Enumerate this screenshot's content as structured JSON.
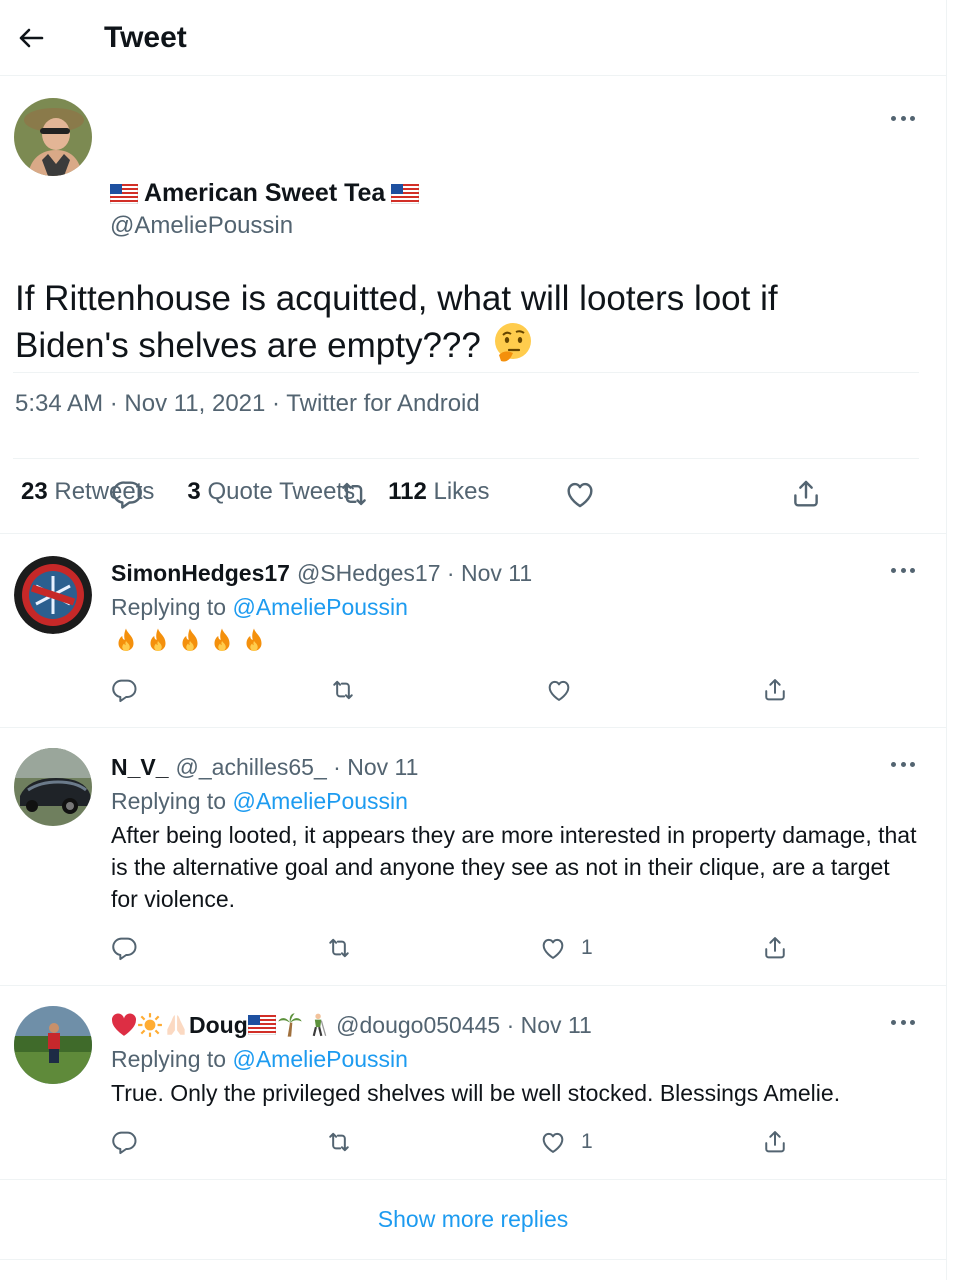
{
  "header": {
    "title": "Tweet"
  },
  "tweet": {
    "author_name": "American Sweet Tea",
    "author_handle": "@AmeliePoussin",
    "text": "If Rittenhouse is acquitted, what will looters loot if Biden's shelves are empty???",
    "time": "5:34 AM",
    "date": "Nov 11, 2021",
    "source": "Twitter for Android",
    "separator": " · ",
    "stats": {
      "retweets_count": "23",
      "retweets_label": "Retweets",
      "quotes_count": "3",
      "quotes_label": "Quote Tweets",
      "likes_count": "112",
      "likes_label": "Likes"
    }
  },
  "replies": [
    {
      "name": "SimonHedges17",
      "handle": "@SHedges17",
      "date": "· Nov 11",
      "replying_label": "Replying to",
      "replying_to": "@AmeliePoussin",
      "text": "",
      "likes": ""
    },
    {
      "name": "N_V_",
      "handle": "@_achilles65_",
      "date": "· Nov 11",
      "replying_label": "Replying to",
      "replying_to": "@AmeliePoussin",
      "text": "After being looted, it appears they are more interested in property damage, that is the alternative goal and anyone they see as not in their clique, are a target for violence.",
      "likes": "1"
    },
    {
      "name": "Doug",
      "handle": "@dougo050445",
      "date": "· Nov 11",
      "replying_label": "Replying to",
      "replying_to": "@AmeliePoussin",
      "text": "True. Only the privileged shelves will be well stocked. Blessings Amelie.",
      "likes": "1"
    }
  ],
  "show_more": "Show more replies",
  "colors": {
    "accent": "#1d9bf0",
    "secondary_text": "#536471",
    "border": "#eff3f4"
  }
}
